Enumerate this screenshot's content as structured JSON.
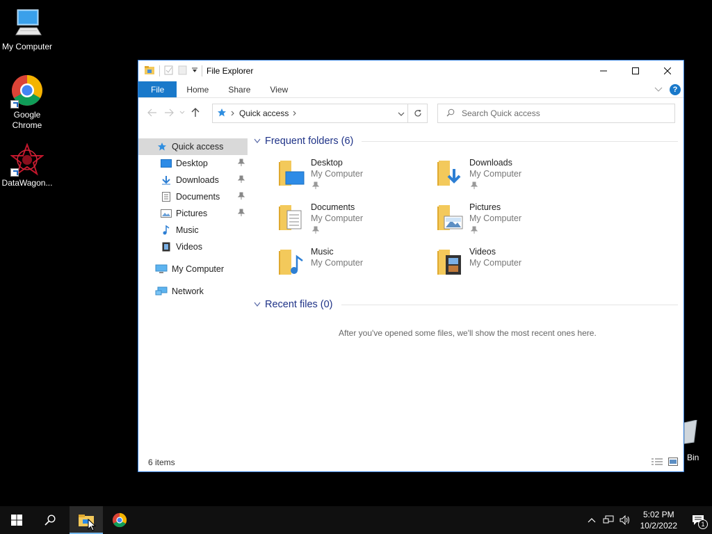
{
  "desktop": {
    "icons": [
      {
        "label": "My Computer"
      },
      {
        "label": "Google Chrome"
      },
      {
        "label": "DataWagon..."
      }
    ],
    "bin_peek": "Bin"
  },
  "window": {
    "title": "File Explorer",
    "ribbon_tabs": [
      "File",
      "Home",
      "Share",
      "View"
    ],
    "help": "?",
    "address": {
      "crumb": "Quick access"
    },
    "search": {
      "placeholder": "Search Quick access"
    },
    "sidebar": [
      {
        "label": "Quick access"
      },
      {
        "label": "Desktop"
      },
      {
        "label": "Downloads"
      },
      {
        "label": "Documents"
      },
      {
        "label": "Pictures"
      },
      {
        "label": "Music"
      },
      {
        "label": "Videos"
      },
      {
        "label": "My Computer"
      },
      {
        "label": "Network"
      }
    ],
    "frequent": {
      "header": "Frequent folders (6)",
      "folders": [
        {
          "name": "Desktop",
          "location": "My Computer"
        },
        {
          "name": "Downloads",
          "location": "My Computer"
        },
        {
          "name": "Documents",
          "location": "My Computer"
        },
        {
          "name": "Pictures",
          "location": "My Computer"
        },
        {
          "name": "Music",
          "location": "My Computer"
        },
        {
          "name": "Videos",
          "location": "My Computer"
        }
      ]
    },
    "recent": {
      "header": "Recent files (0)",
      "empty_message": "After you've opened some files, we'll show the most recent ones here."
    },
    "status": "6 items"
  },
  "taskbar": {
    "time": "5:02 PM",
    "date": "10/2/2022",
    "notification_count": "1"
  },
  "colors": {
    "accent": "#1979ca",
    "folder": "#f3c95b",
    "group_header": "#1e3287"
  }
}
